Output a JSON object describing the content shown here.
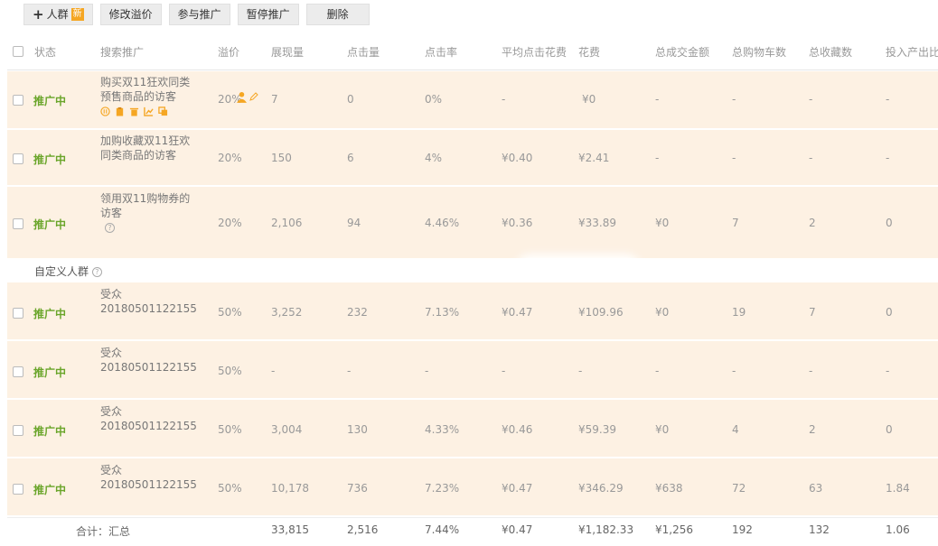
{
  "toolbar": {
    "add_label": "人群",
    "add_badge": "新",
    "buttons": [
      "修改溢价",
      "参与推广",
      "暂停推广",
      "删除"
    ]
  },
  "columns": [
    "状态",
    "搜索推广",
    "溢价",
    "展现量",
    "点击量",
    "点击率",
    "平均点击花费",
    "花费",
    "总成交金额",
    "总购物车数",
    "总收藏数",
    "投入产出比"
  ],
  "rows": [
    {
      "status": "推广中",
      "name": "购买双11狂欢同类预售商品的访客",
      "premium": "20%",
      "impressions": "7",
      "clicks": "0",
      "ctr": "0%",
      "avg_cpc": "-",
      "cost": "¥0",
      "gmv": "-",
      "carts": "-",
      "favs": "-",
      "roi": "-"
    },
    {
      "status": "推广中",
      "name": "加购收藏双11狂欢同类商品的访客",
      "premium": "20%",
      "impressions": "150",
      "clicks": "6",
      "ctr": "4%",
      "avg_cpc": "¥0.40",
      "cost": "¥2.41",
      "gmv": "-",
      "carts": "-",
      "favs": "-",
      "roi": "-"
    },
    {
      "status": "推广中",
      "name": "领用双11购物券的访客",
      "premium": "20%",
      "impressions": "2,106",
      "clicks": "94",
      "ctr": "4.46%",
      "avg_cpc": "¥0.36",
      "cost": "¥33.89",
      "gmv": "¥0",
      "carts": "7",
      "favs": "2",
      "roi": "0"
    },
    {
      "status": "推广中",
      "name": "受众20180501122155",
      "premium": "50%",
      "impressions": "3,252",
      "clicks": "232",
      "ctr": "7.13%",
      "avg_cpc": "¥0.47",
      "cost": "¥109.96",
      "gmv": "¥0",
      "carts": "19",
      "favs": "7",
      "roi": "0"
    },
    {
      "status": "推广中",
      "name": "受众20180501122155",
      "premium": "50%",
      "impressions": "-",
      "clicks": "-",
      "ctr": "-",
      "avg_cpc": "-",
      "cost": "-",
      "gmv": "-",
      "carts": "-",
      "favs": "-",
      "roi": "-"
    },
    {
      "status": "推广中",
      "name": "受众20180501122155",
      "premium": "50%",
      "impressions": "3,004",
      "clicks": "130",
      "ctr": "4.33%",
      "avg_cpc": "¥0.46",
      "cost": "¥59.39",
      "gmv": "¥0",
      "carts": "4",
      "favs": "2",
      "roi": "0"
    },
    {
      "status": "推广中",
      "name": "受众20180501122155",
      "premium": "50%",
      "impressions": "10,178",
      "clicks": "736",
      "ctr": "7.23%",
      "avg_cpc": "¥0.47",
      "cost": "¥346.29",
      "gmv": "¥638",
      "carts": "72",
      "favs": "63",
      "roi": "1.84"
    }
  ],
  "section_label": "自定义人群",
  "help_glyph": "?",
  "total": {
    "label": "合计：汇总",
    "impressions": "33,815",
    "clicks": "2,516",
    "ctr": "7.44%",
    "avg_cpc": "¥0.47",
    "cost": "¥1,182.33",
    "gmv": "¥1,256",
    "carts": "192",
    "favs": "132",
    "roi": "1.06"
  },
  "colors": {
    "row_bg": "#fdf1e3",
    "status": "#6aa52a",
    "accent": "#f5a623"
  }
}
